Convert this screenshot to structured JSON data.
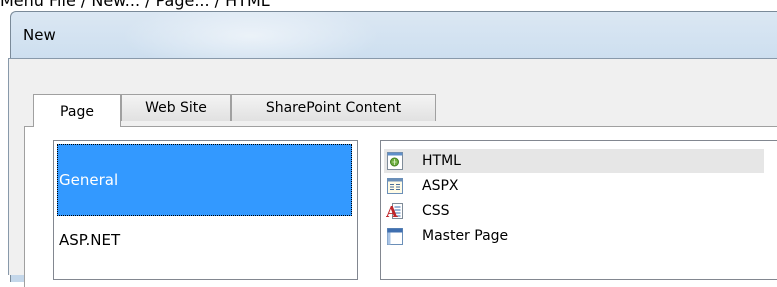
{
  "header": {
    "breadcrumb": "Menu File / New... / Page... / HTML"
  },
  "dialog": {
    "title": "New"
  },
  "tabs": [
    {
      "label": "Page",
      "active": true
    },
    {
      "label": "Web Site",
      "active": false
    },
    {
      "label": "SharePoint Content",
      "active": false
    }
  ],
  "categories": [
    {
      "label": "General",
      "selected": true
    },
    {
      "label": "ASP.NET",
      "selected": false
    }
  ],
  "files": [
    {
      "label": "HTML",
      "icon": "html-page-icon",
      "hover": true
    },
    {
      "label": "ASPX",
      "icon": "aspx-page-icon",
      "hover": false
    },
    {
      "label": "CSS",
      "icon": "css-page-icon",
      "hover": false
    },
    {
      "label": "Master Page",
      "icon": "master-page-icon",
      "hover": false
    }
  ],
  "colors": {
    "selection": "#3399ff",
    "title_bar": "#cfe0f0",
    "hover_row": "#e6e6e6"
  }
}
